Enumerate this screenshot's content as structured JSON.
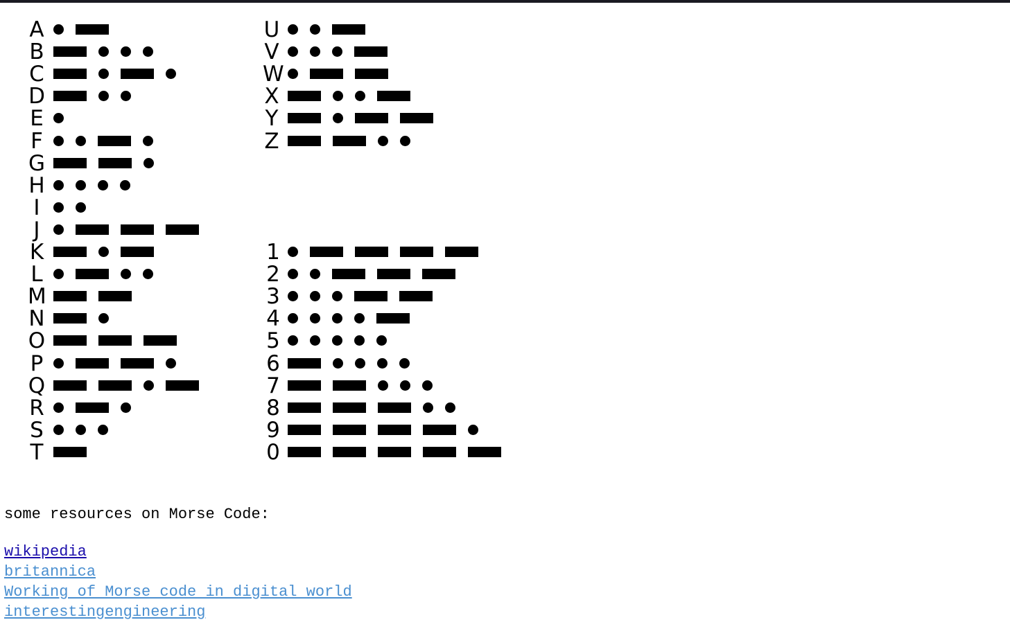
{
  "morse_left": [
    {
      "char": "A",
      "code": ".-"
    },
    {
      "char": "B",
      "code": "-..."
    },
    {
      "char": "C",
      "code": "-.-."
    },
    {
      "char": "D",
      "code": "-.."
    },
    {
      "char": "E",
      "code": "."
    },
    {
      "char": "F",
      "code": "..-."
    },
    {
      "char": "G",
      "code": "--."
    },
    {
      "char": "H",
      "code": "...."
    },
    {
      "char": "I",
      "code": ".."
    },
    {
      "char": "J",
      "code": ".---"
    },
    {
      "char": "K",
      "code": "-.-"
    },
    {
      "char": "L",
      "code": ".-.."
    },
    {
      "char": "M",
      "code": "--"
    },
    {
      "char": "N",
      "code": "-."
    },
    {
      "char": "O",
      "code": "---"
    },
    {
      "char": "P",
      "code": ".--."
    },
    {
      "char": "Q",
      "code": "--.-"
    },
    {
      "char": "R",
      "code": ".-."
    },
    {
      "char": "S",
      "code": "..."
    },
    {
      "char": "T",
      "code": "-"
    }
  ],
  "morse_right_letters": [
    {
      "char": "U",
      "code": "..-"
    },
    {
      "char": "V",
      "code": "...-"
    },
    {
      "char": "W",
      "code": ".--"
    },
    {
      "char": "X",
      "code": "-..-"
    },
    {
      "char": "Y",
      "code": "-.--"
    },
    {
      "char": "Z",
      "code": "--.."
    }
  ],
  "morse_right_digits": [
    {
      "char": "1",
      "code": ".----"
    },
    {
      "char": "2",
      "code": "..---"
    },
    {
      "char": "3",
      "code": "...--"
    },
    {
      "char": "4",
      "code": "....-"
    },
    {
      "char": "5",
      "code": "....."
    },
    {
      "char": "6",
      "code": "-...."
    },
    {
      "char": "7",
      "code": "--..."
    },
    {
      "char": "8",
      "code": "---.."
    },
    {
      "char": "9",
      "code": "----."
    },
    {
      "char": "0",
      "code": "-----"
    }
  ],
  "resources": {
    "title": "some resources on Morse Code:",
    "links": [
      {
        "label": "wikipedia",
        "state": "visited",
        "color": "#1a0dab"
      },
      {
        "label": "britannica",
        "state": "unvisited",
        "color": "#4a8fd0"
      },
      {
        "label": "Working of Morse code in digital world",
        "state": "unvisited",
        "color": "#4a8fd0"
      },
      {
        "label": "interestingengineering",
        "state": "unvisited",
        "color": "#4a8fd0"
      }
    ]
  }
}
